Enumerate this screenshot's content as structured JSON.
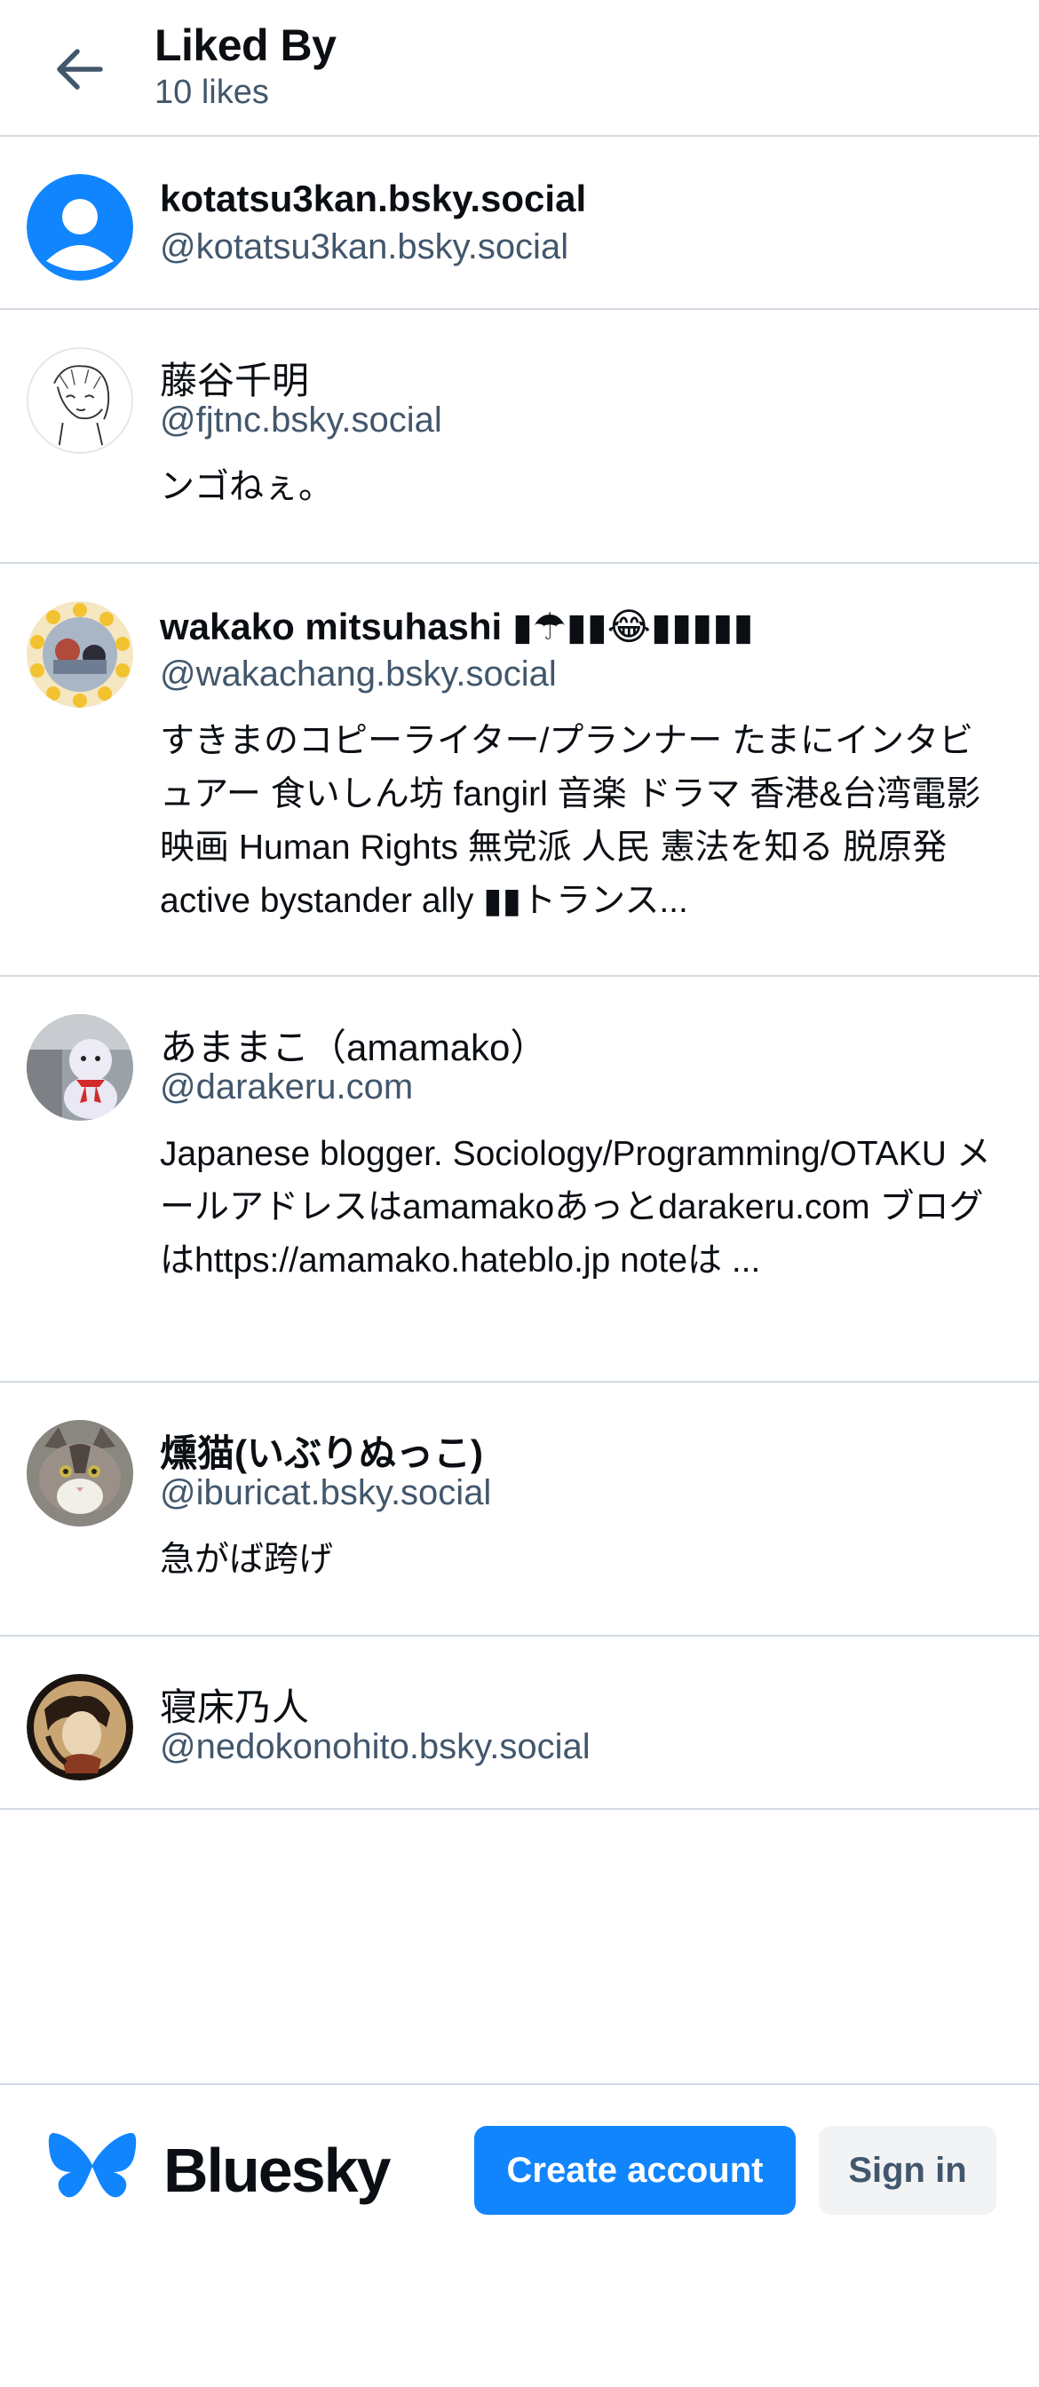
{
  "header": {
    "back_icon": "arrow-left-icon",
    "title": "Liked By",
    "subtitle": "10 likes"
  },
  "users": [
    {
      "name": "kotatsu3kan.bsky.social",
      "handle": "@kotatsu3kan.bsky.social",
      "bio": ""
    },
    {
      "name": "藤谷千明",
      "handle": "@fjtnc.bsky.social",
      "bio": "ンゴねぇ。"
    },
    {
      "name": "wakako mitsuhashi ▮☂▮▮😂▮▮▮▮▮",
      "handle": "@wakachang.bsky.social",
      "bio": "すきまのコピーライター/プランナー たまにインタビュアー 食いしん坊 fangirl 音楽 ドラマ 香港&台湾電影 映画 Human Rights 無党派 人民 憲法を知る 脱原発 active bystander ally ▮▮トランス..."
    },
    {
      "name": "あままこ（amamako）",
      "handle": "@darakeru.com",
      "bio": "Japanese blogger. Sociology/Programming/OTAKU メールアドレスはamamakoあっとdarakeru.com ブログはhttps://amamako.hateblo.jp noteは ..."
    },
    {
      "name": "燻猫(いぶりぬっこ)",
      "handle": "@iburicat.bsky.social",
      "bio": "急がば跨げ"
    },
    {
      "name": "寝床乃人",
      "handle": "@nedokonohito.bsky.social",
      "bio": ""
    }
  ],
  "footer": {
    "brand": "Bluesky",
    "create_account": "Create account",
    "sign_in": "Sign in",
    "accent": "#1185fe"
  }
}
